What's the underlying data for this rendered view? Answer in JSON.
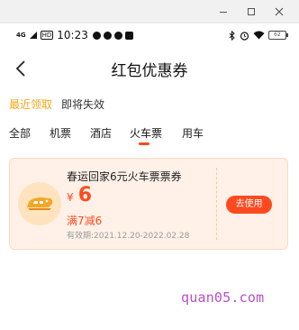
{
  "window_controls": {
    "minimize": "—",
    "maximize": "☐",
    "close": "✕"
  },
  "status_bar": {
    "network": "4G",
    "hd": "HD",
    "time": "10:23",
    "battery": "62"
  },
  "header": {
    "title": "红包优惠券"
  },
  "subtabs": {
    "recent": "最近领取",
    "expiring": "即将失效"
  },
  "categories": {
    "all": "全部",
    "flight": "机票",
    "hotel": "酒店",
    "train": "火车票",
    "car": "用车"
  },
  "coupon": {
    "title": "春运回家6元火车票票券",
    "currency": "¥",
    "amount": "6",
    "condition": "满7减6",
    "validity": "有效期:2021.12.20-2022.02.28",
    "use_label": "去使用"
  },
  "watermark": "quan05.com",
  "colors": {
    "accent": "#ff4a1f",
    "gold": "#f0a81a",
    "card_bg": "#fff1e8"
  }
}
